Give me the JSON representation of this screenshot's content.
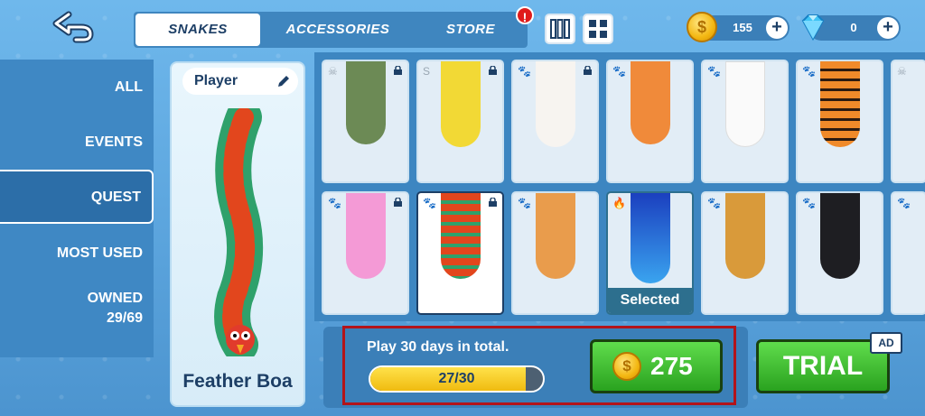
{
  "tabs": {
    "snakes": "SNAKES",
    "accessories": "ACCESSORIES",
    "store": "STORE",
    "store_badge": "!"
  },
  "currency": {
    "coins": "155",
    "gems": "0"
  },
  "sidebar": {
    "items": [
      {
        "label": "ALL"
      },
      {
        "label": "EVENTS"
      },
      {
        "label": "QUEST"
      },
      {
        "label": "MOST USED"
      },
      {
        "label": "OWNED"
      },
      {
        "label": "29/69"
      }
    ]
  },
  "preview": {
    "player_label": "Player",
    "snake_name": "Feather Boa"
  },
  "cards": [
    {
      "name": "zombie-snake"
    },
    {
      "name": "hamster-snake"
    },
    {
      "name": "bunny-snake"
    },
    {
      "name": "fox-snake"
    },
    {
      "name": "white-cat-snake"
    },
    {
      "name": "tiger-snake"
    },
    {
      "name": "pink-cat-snake"
    },
    {
      "name": "feather-boa-snake"
    },
    {
      "name": "corgi-snake"
    },
    {
      "name": "ice-dragon-snake",
      "label": "Selected"
    },
    {
      "name": "lion-snake"
    },
    {
      "name": "black-panther-snake"
    }
  ],
  "quest": {
    "text": "Play 30 days in total.",
    "progress_text": "27/30",
    "progress": 0.9
  },
  "buy": {
    "price": "275"
  },
  "trial": {
    "label": "TRIAL",
    "ad": "AD"
  },
  "colors": {
    "accent_green": "#2aa21f",
    "dark_blue": "#1d3f66",
    "highlight_red": "#b3141a"
  }
}
